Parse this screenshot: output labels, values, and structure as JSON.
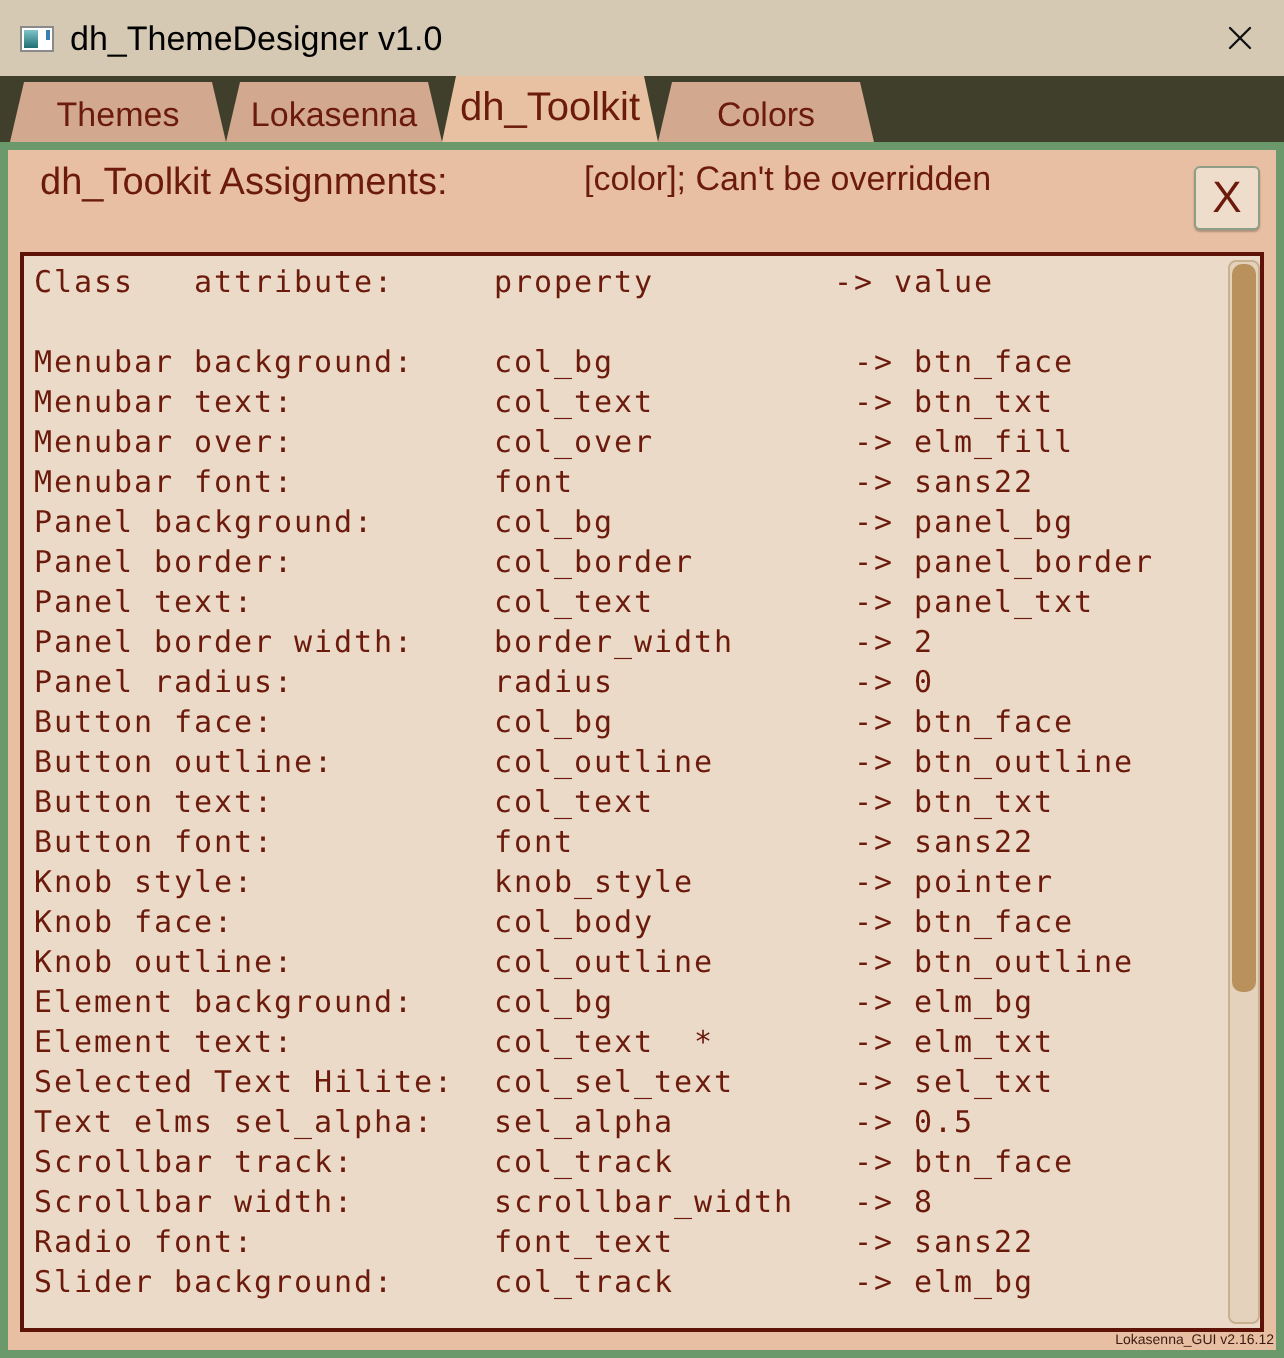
{
  "window": {
    "title": "dh_ThemeDesigner v1.0"
  },
  "tabs": [
    {
      "label": "Themes",
      "selected": false
    },
    {
      "label": "Lokasenna",
      "selected": false
    },
    {
      "label": "dh_Toolkit",
      "selected": true
    },
    {
      "label": "Colors",
      "selected": false
    }
  ],
  "panel": {
    "heading": "dh_Toolkit Assignments:",
    "note": "[color]; Can't be overridden",
    "close_button": "X"
  },
  "assignments": {
    "header": {
      "attribute": "Class   attribute:",
      "property": "property",
      "value": "-> value"
    },
    "rows": [
      {
        "attribute": "Menubar background:",
        "property": "col_bg",
        "value": "-> btn_face"
      },
      {
        "attribute": "Menubar text:",
        "property": "col_text",
        "value": "-> btn_txt"
      },
      {
        "attribute": "Menubar over:",
        "property": "col_over",
        "value": "-> elm_fill"
      },
      {
        "attribute": "Menubar font:",
        "property": "font",
        "value": "-> sans22"
      },
      {
        "attribute": "Panel background:",
        "property": "col_bg",
        "value": "-> panel_bg"
      },
      {
        "attribute": "Panel border:",
        "property": "col_border",
        "value": "-> panel_border"
      },
      {
        "attribute": "Panel text:",
        "property": "col_text",
        "value": "-> panel_txt"
      },
      {
        "attribute": "Panel border width:",
        "property": "border_width",
        "value": "-> 2"
      },
      {
        "attribute": "Panel radius:",
        "property": "radius",
        "value": "-> 0"
      },
      {
        "attribute": "Button face:",
        "property": "col_bg",
        "value": "-> btn_face"
      },
      {
        "attribute": "Button outline:",
        "property": "col_outline",
        "value": "-> btn_outline"
      },
      {
        "attribute": "Button text:",
        "property": "col_text",
        "value": "-> btn_txt"
      },
      {
        "attribute": "Button font:",
        "property": "font",
        "value": "-> sans22"
      },
      {
        "attribute": "Knob style:",
        "property": "knob_style",
        "value": "-> pointer"
      },
      {
        "attribute": "Knob face:",
        "property": "col_body",
        "value": "-> btn_face"
      },
      {
        "attribute": "Knob outline:",
        "property": "col_outline",
        "value": "-> btn_outline"
      },
      {
        "attribute": "Element background:",
        "property": "col_bg",
        "value": "-> elm_bg"
      },
      {
        "attribute": "Element text:",
        "property": "col_text  *",
        "value": "-> elm_txt"
      },
      {
        "attribute": "Selected Text Hilite:",
        "property": "col_sel_text",
        "value": "-> sel_txt"
      },
      {
        "attribute": "Text elms sel_alpha:",
        "property": "sel_alpha",
        "value": "-> 0.5"
      },
      {
        "attribute": "Scrollbar track:",
        "property": "col_track",
        "value": "-> btn_face"
      },
      {
        "attribute": "Scrollbar width:",
        "property": "scrollbar_width",
        "value": "-> 8"
      },
      {
        "attribute": "Radio font:",
        "property": "font_text",
        "value": "-> sans22"
      },
      {
        "attribute": "Slider background:",
        "property": "col_track",
        "value": "-> elm_bg"
      }
    ]
  },
  "footer": "Lokasenna_GUI v2.16.12"
}
